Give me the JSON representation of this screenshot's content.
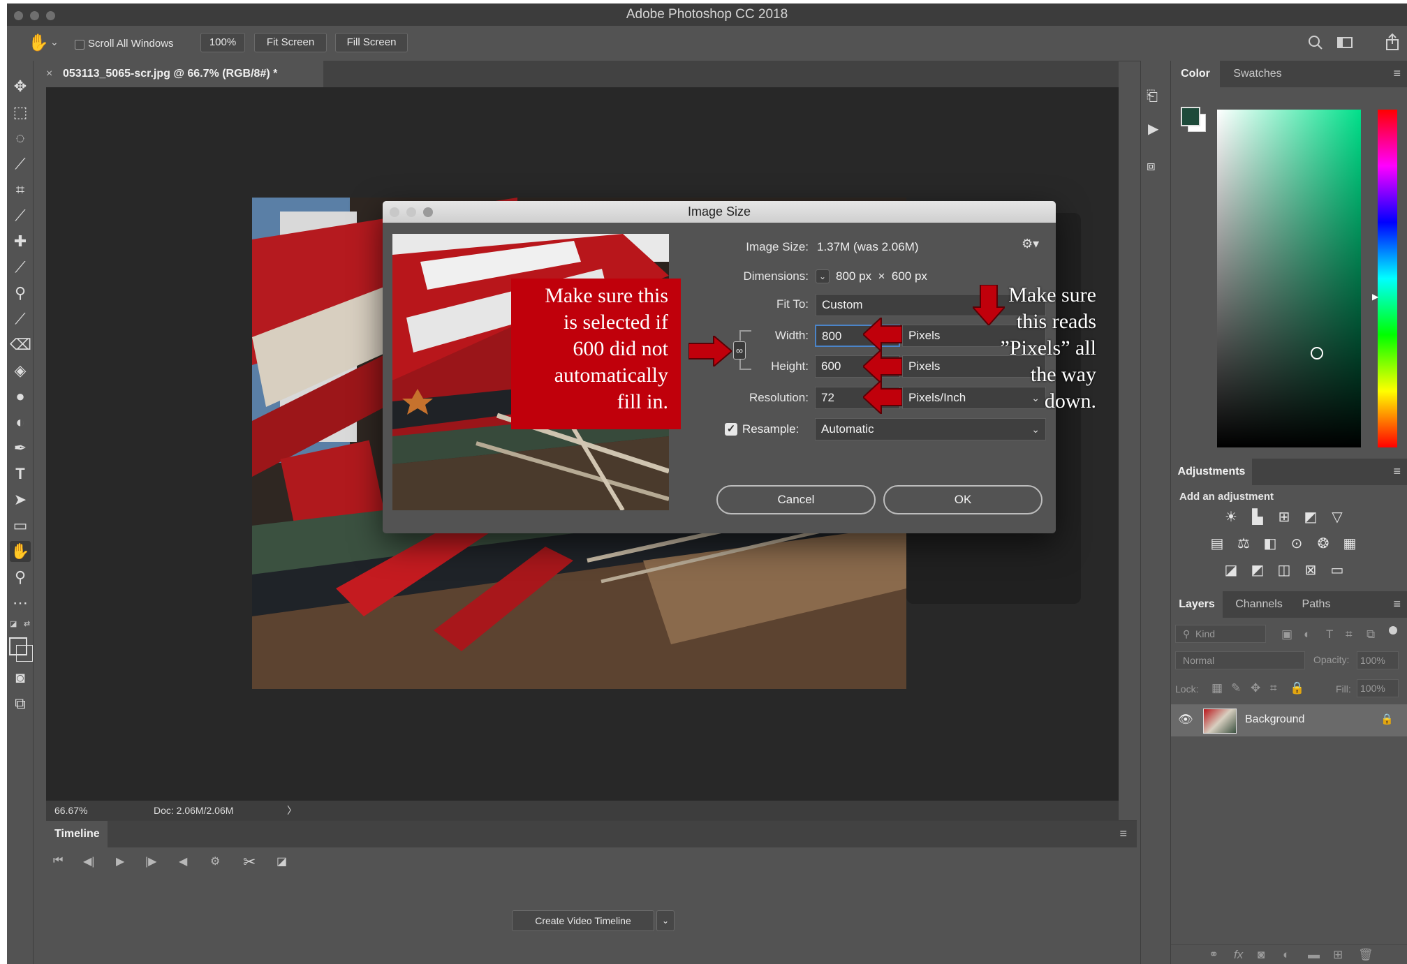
{
  "window": {
    "title": "Adobe Photoshop CC 2018"
  },
  "options_bar": {
    "scroll_all_windows": "Scroll All Windows",
    "zoom_button": "100%",
    "fit_screen": "Fit Screen",
    "fill_screen": "Fill Screen"
  },
  "document": {
    "tab_title": "053113_5065-scr.jpg @ 66.7% (RGB/8#) *",
    "close_glyph": "×",
    "zoom_level": "66.67%",
    "doc_info": "Doc: 2.06M/2.06M",
    "status_arrow": "〉"
  },
  "dialog": {
    "title": "Image Size",
    "image_size_label": "Image Size:",
    "image_size_value": "1.37M (was 2.06M)",
    "dimensions_label": "Dimensions:",
    "dimensions_value": "800 px  ×  600 px",
    "fit_to_label": "Fit To:",
    "fit_to_value": "Custom",
    "width_label": "Width:",
    "width_value": "800",
    "width_unit": "Pixels",
    "height_label": "Height:",
    "height_value": "600",
    "height_unit": "Pixels",
    "resolution_label": "Resolution:",
    "resolution_value": "72",
    "resolution_unit": "Pixels/Inch",
    "resample_label": "Resample:",
    "resample_value": "Automatic",
    "cancel": "Cancel",
    "ok": "OK"
  },
  "annotations": {
    "left_callout": [
      "Make sure this",
      "is selected if",
      "600 did not",
      "automatically",
      "fill in."
    ],
    "right_callout": [
      "Make sure",
      "this reads",
      "”Pixels” all",
      "the way",
      "down."
    ],
    "arrow_color": "#c0000b"
  },
  "timeline": {
    "title": "Timeline",
    "create_button": "Create Video Timeline"
  },
  "color_panel": {
    "tabs": [
      "Color",
      "Swatches"
    ],
    "foreground": "#1e4a3a",
    "background": "#ffffff"
  },
  "adjustments_panel": {
    "title": "Adjustments",
    "subtitle": "Add an adjustment"
  },
  "layers_panel": {
    "tabs": [
      "Layers",
      "Channels",
      "Paths"
    ],
    "kind_placeholder": "Kind",
    "blend_mode": "Normal",
    "opacity_label": "Opacity:",
    "opacity_value": "100%",
    "lock_label": "Lock:",
    "fill_label": "Fill:",
    "fill_value": "100%",
    "layer_name": "Background"
  },
  "toolbox": {
    "foreground": "#1e4a3a",
    "background": "#ffffff"
  }
}
